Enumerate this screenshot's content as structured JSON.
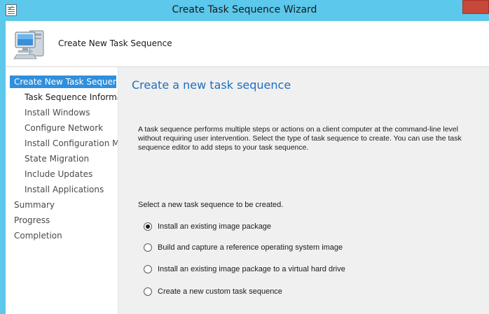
{
  "window": {
    "title": "Create Task Sequence Wizard"
  },
  "header": {
    "title": "Create New Task Sequence",
    "icon": "computer-icon"
  },
  "sidebar": {
    "items": [
      {
        "label": "Create New Task Sequence",
        "level": "top",
        "active": true
      },
      {
        "label": "Task Sequence Information",
        "level": "sub"
      },
      {
        "label": "Install Windows",
        "level": "sub"
      },
      {
        "label": "Configure Network",
        "level": "sub"
      },
      {
        "label": "Install Configuration Manager",
        "level": "sub"
      },
      {
        "label": "State Migration",
        "level": "sub"
      },
      {
        "label": "Include Updates",
        "level": "sub"
      },
      {
        "label": "Install Applications",
        "level": "sub"
      },
      {
        "label": "Summary",
        "level": "top"
      },
      {
        "label": "Progress",
        "level": "top"
      },
      {
        "label": "Completion",
        "level": "top"
      }
    ]
  },
  "main": {
    "title": "Create a new task sequence",
    "description": "A task sequence performs multiple steps or actions on a client computer at the command-line level without requiring user intervention. Select the type of task sequence to create. You can use the task sequence editor to add steps to your task sequence.",
    "select_label": "Select a new task sequence to be created.",
    "options": [
      {
        "label": "Install an existing image package",
        "checked": true
      },
      {
        "label": "Build and capture a reference operating system image",
        "checked": false
      },
      {
        "label": "Install an existing image package to a virtual hard drive",
        "checked": false
      },
      {
        "label": "Create a new custom task sequence",
        "checked": false
      }
    ]
  },
  "colors": {
    "titlebar": "#5bc8ec",
    "accent": "#2f8fdc",
    "heading": "#1e6ebf",
    "close": "#c7473b"
  }
}
